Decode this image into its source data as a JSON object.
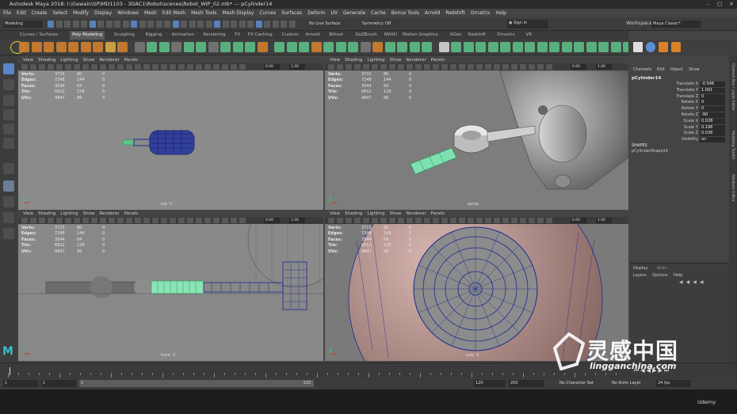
{
  "window": {
    "title": "Autodesk Maya 2018: I:\\Gawain\\SP\\MD1103 - 3DAC1\\Robot\\scenes\\Robot_WIP_02.mb* --- pCylinder14"
  },
  "menu": [
    "File",
    "Edit",
    "Create",
    "Select",
    "Modify",
    "Display",
    "Windows",
    "Mesh",
    "Edit Mesh",
    "Mesh Tools",
    "Mesh Display",
    "Curves",
    "Surfaces",
    "Deform",
    "UV",
    "Generate",
    "Cache",
    "Bonus Tools",
    "Arnold",
    "Redshift",
    "Ornatrix",
    "Help"
  ],
  "status": {
    "mode": "Modeling",
    "live_surface": "No Live Surface",
    "symmetry": "Symmetry: Off",
    "sign_in": "Sign In",
    "workspace_label": "Workspace :",
    "workspace_value": "Maya Classic*"
  },
  "shelf_tabs": [
    "Curves / Surfaces",
    "Poly Modeling",
    "Sculpting",
    "Rigging",
    "Animation",
    "Rendering",
    "FX",
    "FX Caching",
    "Custom",
    "Arnold",
    "Bifrost",
    "GoZBrush",
    "MASH",
    "Motion Graphics",
    "XGen",
    "Redshift",
    "Ornatrix",
    "VR"
  ],
  "viewport_menu": [
    "View",
    "Shading",
    "Lighting",
    "Show",
    "Renderer",
    "Panels"
  ],
  "viewport_value": "0.00",
  "viewport_value2": "1.00",
  "hud": {
    "labels": [
      "Verts:",
      "Edges:",
      "Faces:",
      "Tris:",
      "UVs:"
    ],
    "top": [
      [
        "3715",
        "80",
        "0"
      ],
      [
        "7248",
        "144",
        "0"
      ],
      [
        "3544",
        "64",
        "0"
      ],
      [
        "6912",
        "128",
        "0"
      ],
      [
        "4847",
        "99",
        "0"
      ]
    ],
    "persp": [
      [
        "3715",
        "80",
        "0"
      ],
      [
        "7248",
        "144",
        "0"
      ],
      [
        "3544",
        "64",
        "0"
      ],
      [
        "6912",
        "128",
        "0"
      ],
      [
        "4847",
        "99",
        "0"
      ]
    ],
    "front": [
      [
        "3715",
        "80",
        "0"
      ],
      [
        "7248",
        "144",
        "0"
      ],
      [
        "3544",
        "64",
        "0"
      ],
      [
        "6912",
        "128",
        "0"
      ],
      [
        "4847",
        "99",
        "0"
      ]
    ],
    "side": [
      [
        "3715",
        "80",
        "0"
      ],
      [
        "7248",
        "144",
        "0"
      ],
      [
        "3544",
        "64",
        "0"
      ],
      [
        "6912",
        "128",
        "0"
      ],
      [
        "4847",
        "99",
        "0"
      ]
    ]
  },
  "cameras": {
    "top": "top -Y",
    "persp": "persp",
    "front": "front -Z",
    "side": "side -X"
  },
  "channel_box": {
    "menu": [
      "Channels",
      "Edit",
      "Object",
      "Show"
    ],
    "object": "pCylinder14",
    "attributes": [
      {
        "name": "Translate X",
        "value": "-0.548"
      },
      {
        "name": "Translate Y",
        "value": "1.001"
      },
      {
        "name": "Translate Z",
        "value": "0"
      },
      {
        "name": "Rotate X",
        "value": "0"
      },
      {
        "name": "Rotate Y",
        "value": "0"
      },
      {
        "name": "Rotate Z",
        "value": "-90"
      },
      {
        "name": "Scale X",
        "value": "0.028"
      },
      {
        "name": "Scale Y",
        "value": "0.198"
      },
      {
        "name": "Scale Z",
        "value": "0.028"
      },
      {
        "name": "Visibility",
        "value": "on"
      }
    ],
    "shapes_header": "SHAPES",
    "shape_name": "pCylinderShape14"
  },
  "layer_editor": {
    "tabs": [
      "Display",
      "Anim"
    ],
    "menu": [
      "Layers",
      "Options",
      "Help"
    ]
  },
  "side_tabs": [
    "Channel Box / Layer Editor",
    "Modeling Toolkit",
    "Attribute Editor"
  ],
  "timeline": {
    "start_frame": "1",
    "current_frame": "1",
    "range_start": "1",
    "range_inner_start": "1",
    "range_inner_end": "120",
    "range_end": "120",
    "anim_end": "200",
    "character_set": "No Character Set",
    "anim_layer": "No Anim Layer",
    "fps": "24 fps"
  },
  "watermark": {
    "brand_cn": "灵感中国",
    "brand_url": "lingganchina.com",
    "udemy": "Udemy"
  },
  "colors": {
    "accent_green": "#5ec48a",
    "poly_blue": "#1b2a8f",
    "shelf_orange": "#d9822b"
  }
}
